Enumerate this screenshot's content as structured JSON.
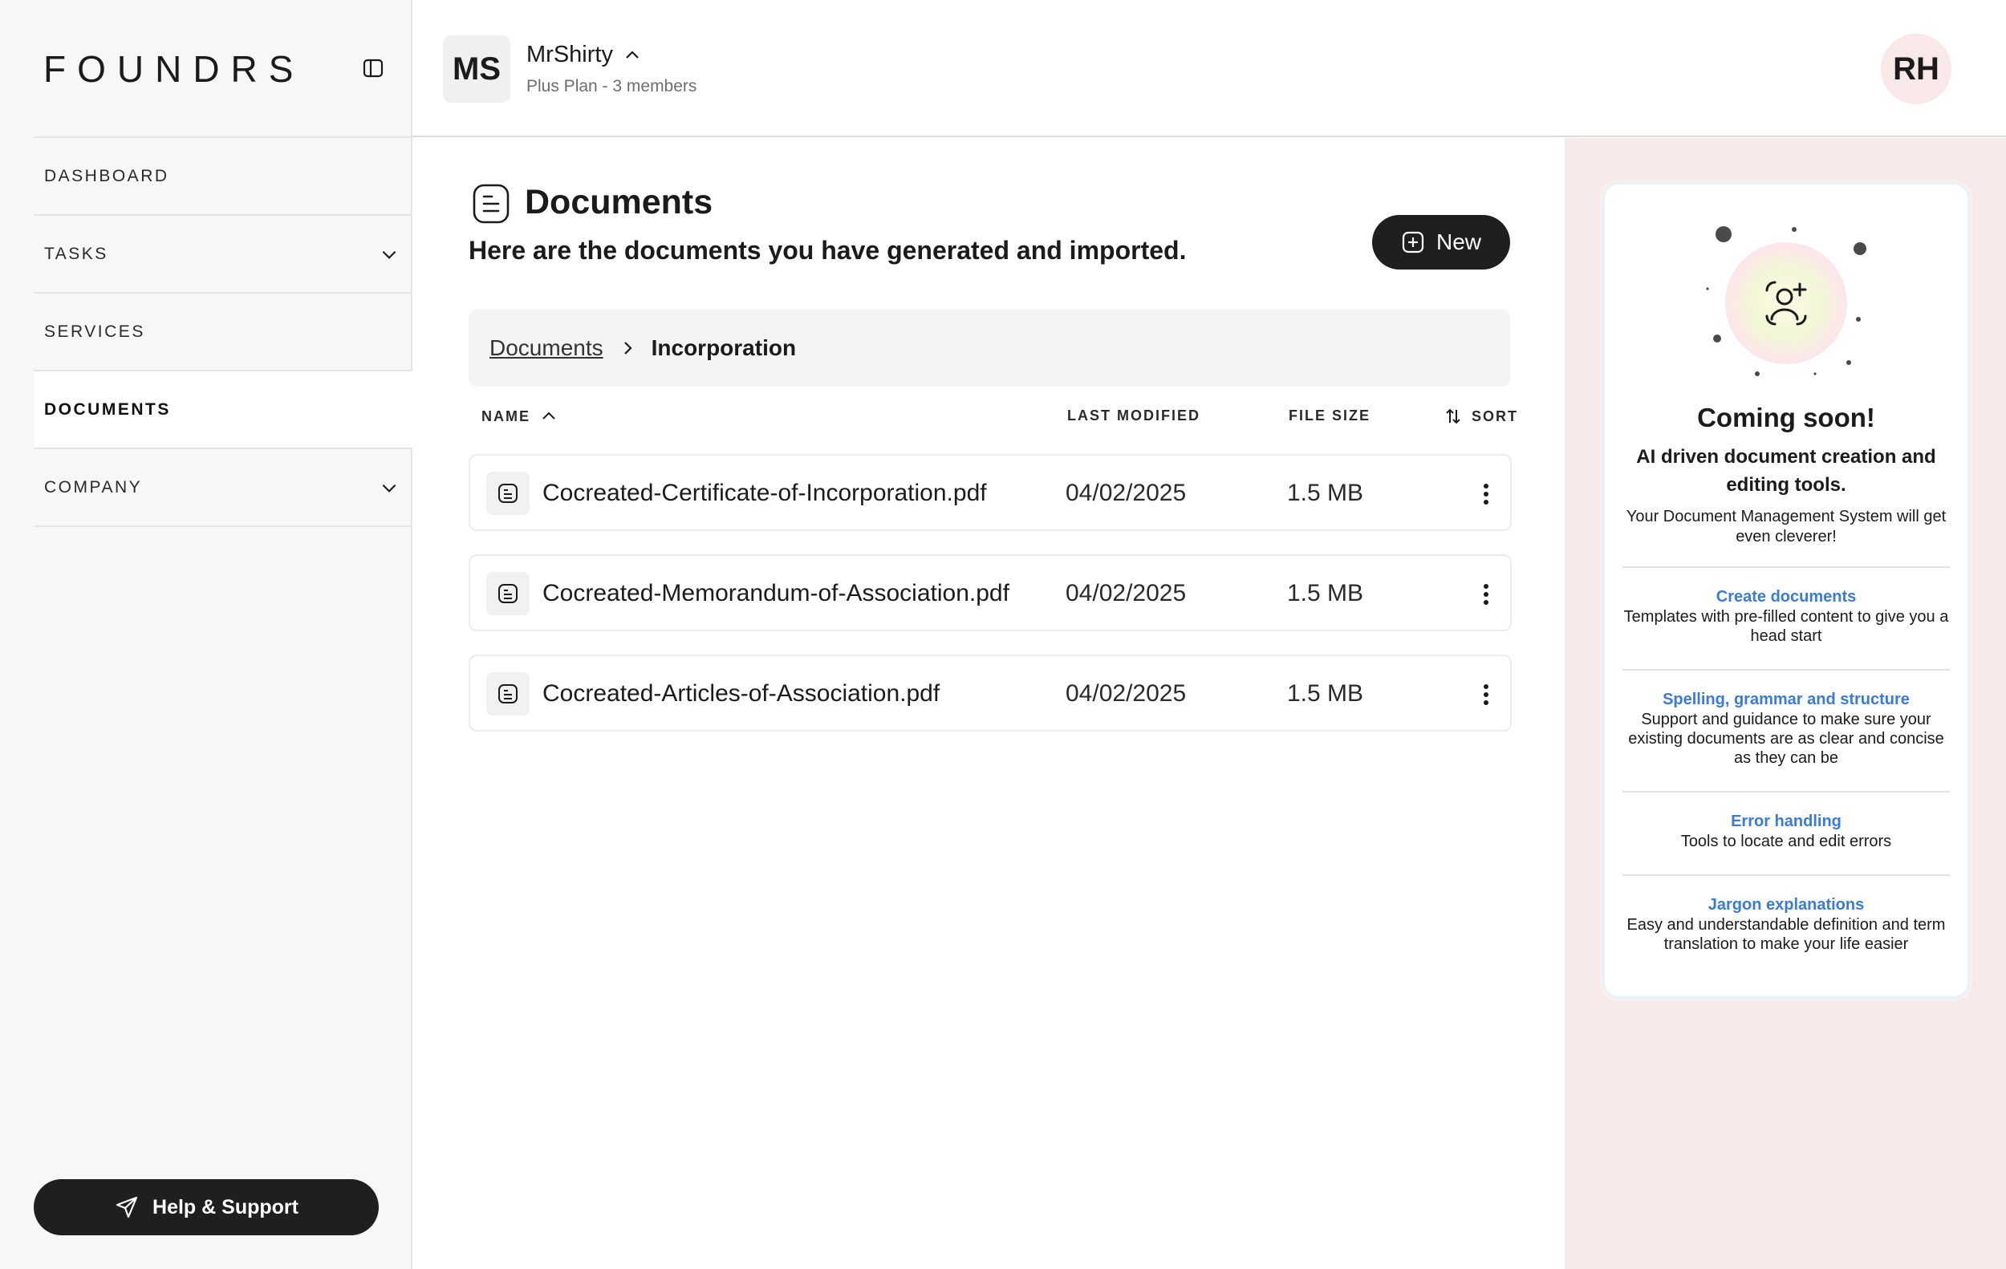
{
  "brand": {
    "logo_text": "FOUNDRS"
  },
  "sidebar": {
    "items": [
      {
        "label": "DASHBOARD",
        "has_chevron": false,
        "active": false
      },
      {
        "label": "TASKS",
        "has_chevron": true,
        "active": false
      },
      {
        "label": "SERVICES",
        "has_chevron": false,
        "active": false
      },
      {
        "label": "DOCUMENTS",
        "has_chevron": false,
        "active": true
      },
      {
        "label": "COMPANY",
        "has_chevron": true,
        "active": false
      }
    ],
    "help_label": "Help & Support"
  },
  "header": {
    "org_initials": "MS",
    "org_name": "MrShirty",
    "org_plan": "Plus Plan - 3 members",
    "user_initials": "RH"
  },
  "main": {
    "title": "Documents",
    "subtitle": "Here are the documents you have generated and imported.",
    "new_label": "New",
    "breadcrumb": {
      "root": "Documents",
      "current": "Incorporation"
    },
    "columns": {
      "name": "NAME",
      "modified": "LAST MODIFIED",
      "size": "FILE SIZE",
      "sort": "SORT"
    },
    "files": [
      {
        "name": "Cocreated-Certificate-of-Incorporation.pdf",
        "modified": "04/02/2025",
        "size": "1.5 MB"
      },
      {
        "name": "Cocreated-Memorandum-of-Association.pdf",
        "modified": "04/02/2025",
        "size": "1.5 MB"
      },
      {
        "name": "Cocreated-Articles-of-Association.pdf",
        "modified": "04/02/2025",
        "size": "1.5 MB"
      }
    ]
  },
  "promo": {
    "title": "Coming soon!",
    "subtitle": "AI driven document creation and editing tools.",
    "description": "Your Document Management System will get even cleverer!",
    "features": [
      {
        "title": "Create documents",
        "desc": "Templates with pre-filled content to give you a head start"
      },
      {
        "title": "Spelling, grammar and structure",
        "desc": "Support and guidance to make sure your existing documents are as clear and concise as they can be"
      },
      {
        "title": "Error handling",
        "desc": "Tools to locate and edit errors"
      },
      {
        "title": "Jargon explanations",
        "desc": "Easy and understandable definition and term translation to make your life easier"
      }
    ]
  },
  "colors": {
    "accent_link": "#3a7bd5",
    "button_dark": "#1f1f1f",
    "panel_bg": "#f8eaea"
  }
}
